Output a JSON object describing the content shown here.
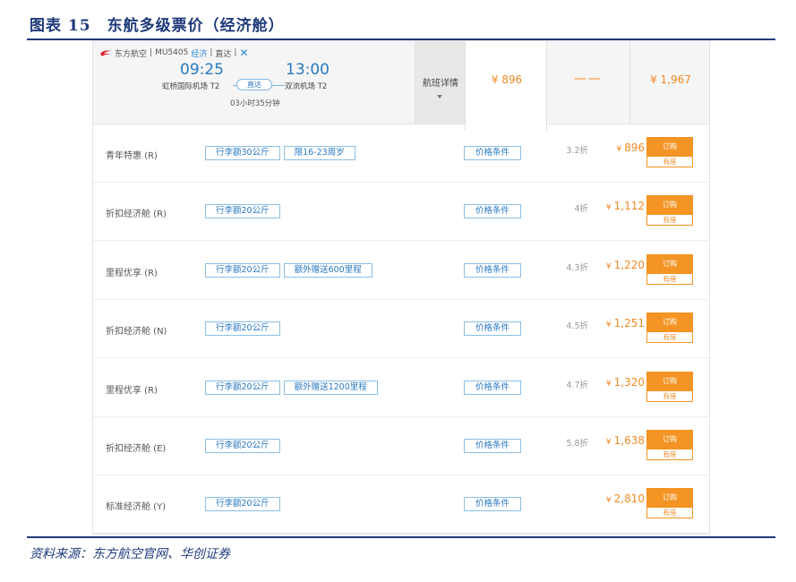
{
  "figure": {
    "title": "图表 15　东航多级票价（经济舱）",
    "source": "资料来源：东方航空官网、华创证券"
  },
  "flight": {
    "airline": "东方航空",
    "flight_no": "MU5405",
    "plane_tag": "经济",
    "direct_short": "直达",
    "dep_time": "09:25",
    "arr_time": "13:00",
    "dep_airport": "虹桥国际机场 T2",
    "arr_airport": "双流机场 T2",
    "direct_label": "直达",
    "duration": "03小时35分钟",
    "detail_label": "航班详情",
    "selected_price": "¥ 896",
    "unavailable": "——",
    "top_price": "¥ 1,967"
  },
  "colors": {
    "brand_blue": "#2a78c2",
    "accent_orange": "#f39424",
    "title_navy": "#1f3a7a"
  },
  "icons": {
    "airline_logo": "china-eastern-logo-icon",
    "close": "close-icon",
    "dropdown": "caret-down-icon"
  },
  "fares": [
    {
      "name": "青年特惠 (R)",
      "tags": [
        "行李额30公斤",
        "限16-23周岁"
      ],
      "condition": "价格条件",
      "discount": "3.2折",
      "currency": "¥",
      "price": "896",
      "book": "订购",
      "seat": "有座"
    },
    {
      "name": "折扣经济舱 (R)",
      "tags": [
        "行李额20公斤"
      ],
      "condition": "价格条件",
      "discount": "4折",
      "currency": "¥",
      "price": "1,112",
      "book": "订购",
      "seat": "有座"
    },
    {
      "name": "里程优享 (R)",
      "tags": [
        "行李额20公斤",
        "额外赠送600里程"
      ],
      "condition": "价格条件",
      "discount": "4.3折",
      "currency": "¥",
      "price": "1,220",
      "book": "订购",
      "seat": "有座"
    },
    {
      "name": "折扣经济舱 (N)",
      "tags": [
        "行李额20公斤"
      ],
      "condition": "价格条件",
      "discount": "4.5折",
      "currency": "¥",
      "price": "1,251",
      "book": "订购",
      "seat": "有座"
    },
    {
      "name": "里程优享 (R)",
      "tags": [
        "行李额20公斤",
        "额外赠送1200里程"
      ],
      "condition": "价格条件",
      "discount": "4.7折",
      "currency": "¥",
      "price": "1,320",
      "book": "订购",
      "seat": "有座"
    },
    {
      "name": "折扣经济舱 (E)",
      "tags": [
        "行李额20公斤"
      ],
      "condition": "价格条件",
      "discount": "5.8折",
      "currency": "¥",
      "price": "1,638",
      "book": "订购",
      "seat": "有座"
    },
    {
      "name": "标准经济舱 (Y)",
      "tags": [
        "行李额20公斤"
      ],
      "condition": "价格条件",
      "discount": "",
      "currency": "¥",
      "price": "2,810",
      "book": "订购",
      "seat": "有座"
    }
  ]
}
